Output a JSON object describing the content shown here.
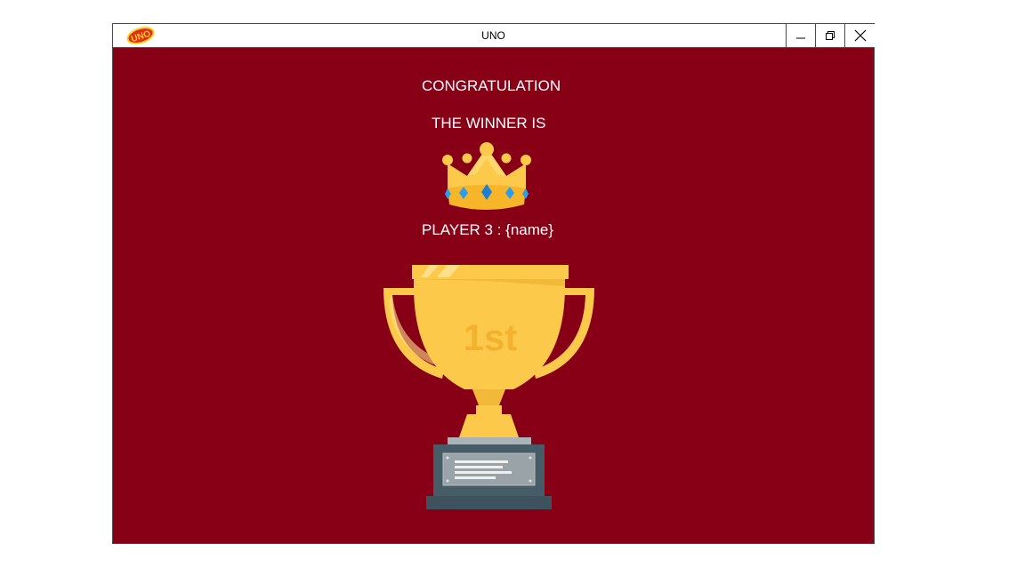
{
  "window": {
    "title": "UNO",
    "logo_text": "UNO",
    "controls": {
      "minimize": "minimize-icon",
      "maximize": "restore-icon",
      "close": "close-icon"
    }
  },
  "winner_screen": {
    "heading": "CONGRATULATION",
    "subheading": "THE WINNER IS",
    "winner_label": "PLAYER 3 : {name}",
    "trophy_text": "1st",
    "icons": [
      "crown-icon",
      "trophy-icon"
    ]
  },
  "colors": {
    "background": "#880015",
    "text": "#ffffff",
    "gold": "#fcc94a",
    "plaque": "#465d68"
  }
}
